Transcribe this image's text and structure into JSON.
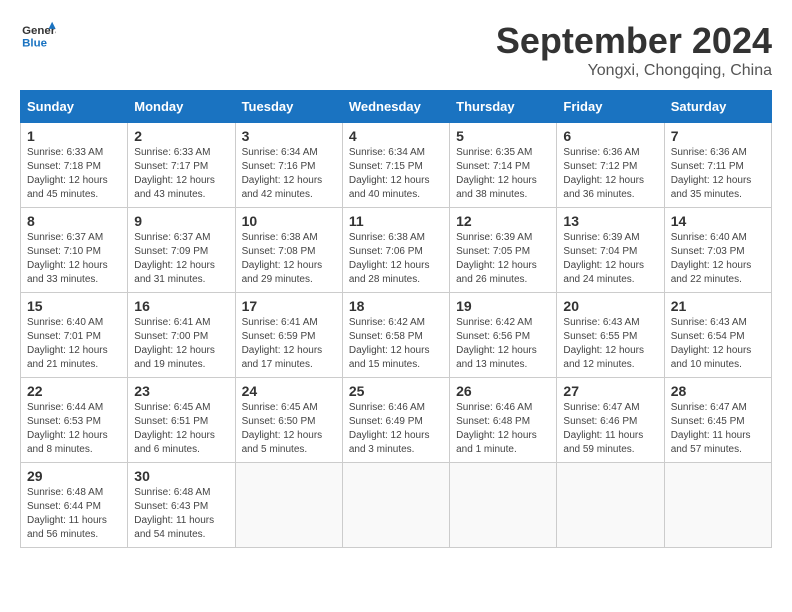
{
  "logo": {
    "text_general": "General",
    "text_blue": "Blue"
  },
  "header": {
    "month": "September 2024",
    "location": "Yongxi, Chongqing, China"
  },
  "weekdays": [
    "Sunday",
    "Monday",
    "Tuesday",
    "Wednesday",
    "Thursday",
    "Friday",
    "Saturday"
  ],
  "weeks": [
    [
      {
        "day": "1",
        "info": "Sunrise: 6:33 AM\nSunset: 7:18 PM\nDaylight: 12 hours and 45 minutes."
      },
      {
        "day": "2",
        "info": "Sunrise: 6:33 AM\nSunset: 7:17 PM\nDaylight: 12 hours and 43 minutes."
      },
      {
        "day": "3",
        "info": "Sunrise: 6:34 AM\nSunset: 7:16 PM\nDaylight: 12 hours and 42 minutes."
      },
      {
        "day": "4",
        "info": "Sunrise: 6:34 AM\nSunset: 7:15 PM\nDaylight: 12 hours and 40 minutes."
      },
      {
        "day": "5",
        "info": "Sunrise: 6:35 AM\nSunset: 7:14 PM\nDaylight: 12 hours and 38 minutes."
      },
      {
        "day": "6",
        "info": "Sunrise: 6:36 AM\nSunset: 7:12 PM\nDaylight: 12 hours and 36 minutes."
      },
      {
        "day": "7",
        "info": "Sunrise: 6:36 AM\nSunset: 7:11 PM\nDaylight: 12 hours and 35 minutes."
      }
    ],
    [
      {
        "day": "8",
        "info": "Sunrise: 6:37 AM\nSunset: 7:10 PM\nDaylight: 12 hours and 33 minutes."
      },
      {
        "day": "9",
        "info": "Sunrise: 6:37 AM\nSunset: 7:09 PM\nDaylight: 12 hours and 31 minutes."
      },
      {
        "day": "10",
        "info": "Sunrise: 6:38 AM\nSunset: 7:08 PM\nDaylight: 12 hours and 29 minutes."
      },
      {
        "day": "11",
        "info": "Sunrise: 6:38 AM\nSunset: 7:06 PM\nDaylight: 12 hours and 28 minutes."
      },
      {
        "day": "12",
        "info": "Sunrise: 6:39 AM\nSunset: 7:05 PM\nDaylight: 12 hours and 26 minutes."
      },
      {
        "day": "13",
        "info": "Sunrise: 6:39 AM\nSunset: 7:04 PM\nDaylight: 12 hours and 24 minutes."
      },
      {
        "day": "14",
        "info": "Sunrise: 6:40 AM\nSunset: 7:03 PM\nDaylight: 12 hours and 22 minutes."
      }
    ],
    [
      {
        "day": "15",
        "info": "Sunrise: 6:40 AM\nSunset: 7:01 PM\nDaylight: 12 hours and 21 minutes."
      },
      {
        "day": "16",
        "info": "Sunrise: 6:41 AM\nSunset: 7:00 PM\nDaylight: 12 hours and 19 minutes."
      },
      {
        "day": "17",
        "info": "Sunrise: 6:41 AM\nSunset: 6:59 PM\nDaylight: 12 hours and 17 minutes."
      },
      {
        "day": "18",
        "info": "Sunrise: 6:42 AM\nSunset: 6:58 PM\nDaylight: 12 hours and 15 minutes."
      },
      {
        "day": "19",
        "info": "Sunrise: 6:42 AM\nSunset: 6:56 PM\nDaylight: 12 hours and 13 minutes."
      },
      {
        "day": "20",
        "info": "Sunrise: 6:43 AM\nSunset: 6:55 PM\nDaylight: 12 hours and 12 minutes."
      },
      {
        "day": "21",
        "info": "Sunrise: 6:43 AM\nSunset: 6:54 PM\nDaylight: 12 hours and 10 minutes."
      }
    ],
    [
      {
        "day": "22",
        "info": "Sunrise: 6:44 AM\nSunset: 6:53 PM\nDaylight: 12 hours and 8 minutes."
      },
      {
        "day": "23",
        "info": "Sunrise: 6:45 AM\nSunset: 6:51 PM\nDaylight: 12 hours and 6 minutes."
      },
      {
        "day": "24",
        "info": "Sunrise: 6:45 AM\nSunset: 6:50 PM\nDaylight: 12 hours and 5 minutes."
      },
      {
        "day": "25",
        "info": "Sunrise: 6:46 AM\nSunset: 6:49 PM\nDaylight: 12 hours and 3 minutes."
      },
      {
        "day": "26",
        "info": "Sunrise: 6:46 AM\nSunset: 6:48 PM\nDaylight: 12 hours and 1 minute."
      },
      {
        "day": "27",
        "info": "Sunrise: 6:47 AM\nSunset: 6:46 PM\nDaylight: 11 hours and 59 minutes."
      },
      {
        "day": "28",
        "info": "Sunrise: 6:47 AM\nSunset: 6:45 PM\nDaylight: 11 hours and 57 minutes."
      }
    ],
    [
      {
        "day": "29",
        "info": "Sunrise: 6:48 AM\nSunset: 6:44 PM\nDaylight: 11 hours and 56 minutes."
      },
      {
        "day": "30",
        "info": "Sunrise: 6:48 AM\nSunset: 6:43 PM\nDaylight: 11 hours and 54 minutes."
      },
      {
        "day": "",
        "info": ""
      },
      {
        "day": "",
        "info": ""
      },
      {
        "day": "",
        "info": ""
      },
      {
        "day": "",
        "info": ""
      },
      {
        "day": "",
        "info": ""
      }
    ]
  ]
}
